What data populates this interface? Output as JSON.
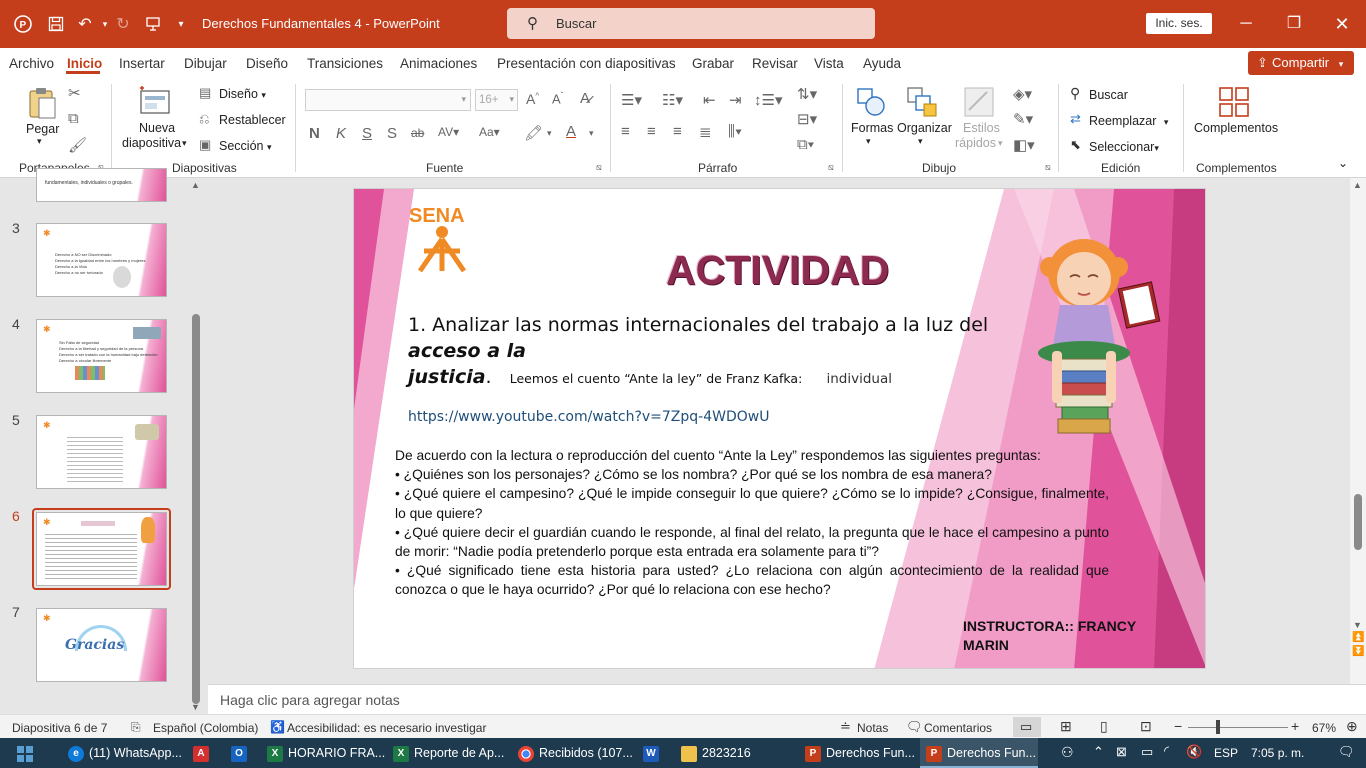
{
  "titlebar": {
    "doc_title": "Derechos Fundamentales 4  -  PowerPoint",
    "search_placeholder": "Buscar",
    "signin": "Inic. ses.",
    "minimize_icon": "minimize-icon",
    "restore_icon": "restore-icon",
    "close_icon": "close-icon"
  },
  "menu": {
    "tabs": [
      "Archivo",
      "Inicio",
      "Insertar",
      "Dibujar",
      "Diseño",
      "Transiciones",
      "Animaciones",
      "Presentación con diapositivas",
      "Grabar",
      "Revisar",
      "Vista",
      "Ayuda"
    ],
    "active_tab": "Inicio",
    "share": "Compartir"
  },
  "ribbon": {
    "paste": "Pegar",
    "new_slide_1": "Nueva",
    "new_slide_2": "diapositiva",
    "layout": "Diseño",
    "reset": "Restablecer",
    "section": "Sección",
    "font_size": "16+",
    "shapes": "Formas",
    "arrange": "Organizar",
    "quick_styles_1": "Estilos",
    "quick_styles_2": "rápidos",
    "find": "Buscar",
    "replace": "Reemplazar",
    "select": "Seleccionar",
    "addins": "Complementos",
    "groups": {
      "clipboard": "Portapapeles",
      "slides": "Diapositivas",
      "font": "Fuente",
      "paragraph": "Párrafo",
      "drawing": "Dibujo",
      "editing": "Edición",
      "addins": "Complementos"
    }
  },
  "thumbnails": {
    "numbers": [
      "3",
      "4",
      "5",
      "6",
      "7"
    ],
    "selected": "6",
    "partial_text": "fundamentales, individuales o grupales.",
    "slide3_lines": [
      "Derecho a NO ser Discriminado",
      "Derecho a la igualdad entre los hombres y mujeres",
      "Derecho a la Vida",
      "Derecho a no ser torturado"
    ],
    "slide4_lines": [
      "Sin Falta de seguridad",
      "Derecho a la libertad y seguridad de la persona",
      "Derecho a ser tratado con la humanidad bajo detención",
      "Derecho a circular libremente"
    ],
    "slide7_text": "Gracias"
  },
  "slide": {
    "logo_text": "SENA",
    "title": "ACTIVIDAD",
    "point_main_1": "1. Analizar las normas internacionales del trabajo a la luz del ",
    "point_bold_1": "acceso a la",
    "point_bold_2": "justicia",
    "point_tail": ".",
    "point_small": "Leemos el cuento “Ante la ley” de Franz Kafka:",
    "point_individual": "individual",
    "link": "https://www.youtube.com/watch?v=7Zpq-4WDOwU",
    "questions": [
      "De acuerdo con la lectura o reproducción del cuento “Ante la Ley” respondemos las siguientes preguntas:",
      "• ¿Quiénes son los personajes? ¿Cómo se los nombra? ¿Por qué se los nombra de esa manera?",
      "• ¿Qué quiere el campesino? ¿Qué le impide conseguir lo que quiere? ¿Cómo se lo impide? ¿Consigue, finalmente, lo que quiere?",
      "• ¿Qué quiere decir el guardián cuando le responde, al final del relato, la pregunta que le hace el campesino a punto de morir: “Nadie podía pretenderlo porque esta entrada era solamente para ti”?",
      "• ¿Qué significado tiene esta historia para usted? ¿Lo relaciona con algún acontecimiento de la realidad que conozca o que le haya ocurrido? ¿Por qué lo relaciona con ese hecho?"
    ],
    "instructor_1": "INSTRUCTORA:: FRANCY",
    "instructor_2": "MARIN"
  },
  "notes_placeholder": "Haga clic para agregar notas",
  "status": {
    "slide_info": "Diapositiva 6 de 7",
    "language": "Español (Colombia)",
    "accessibility": "Accesibilidad: es necesario investigar",
    "notes": "Notas",
    "comments": "Comentarios",
    "zoom": "67%"
  },
  "taskbar": {
    "items": [
      "(11) WhatsApp...",
      "HORARIO FRA...",
      "Reporte de Ap...",
      "Recibidos (107...",
      "2823216",
      "Derechos Fun...",
      "Derechos Fun..."
    ],
    "language": "ESP",
    "time": "7:05 p. m."
  },
  "colors": {
    "accent": "#c43e1c",
    "slide_title": "#8c2a50",
    "slide_pink": "#e0539a",
    "taskbar": "#1e3a4f"
  }
}
